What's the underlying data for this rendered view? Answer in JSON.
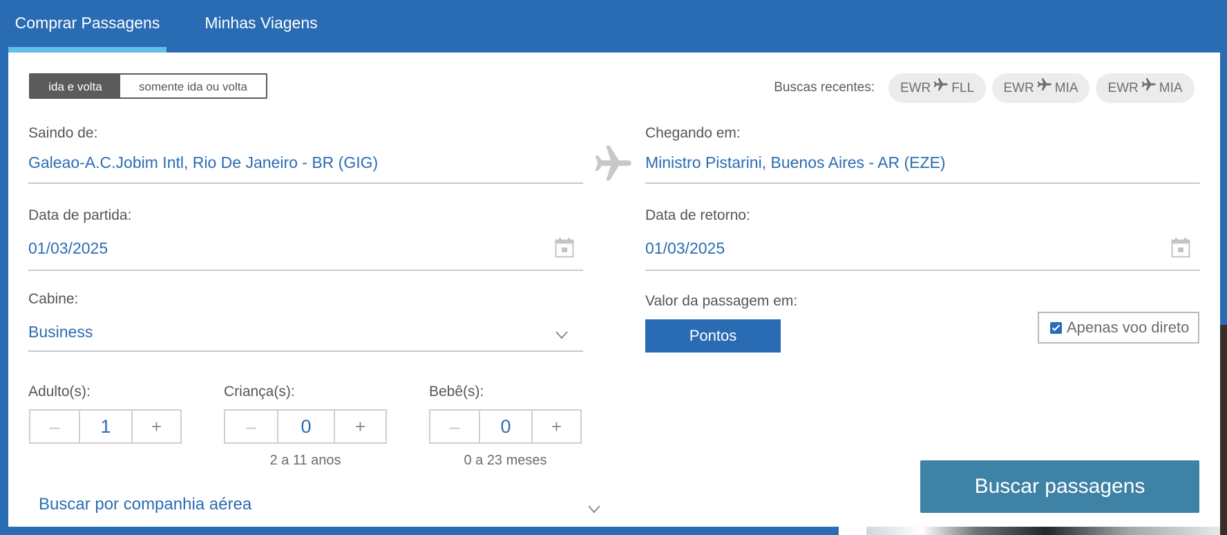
{
  "tabs": {
    "active": "Comprar Passagens",
    "second": "Minhas Viagens"
  },
  "trip_type": {
    "round_trip": "ida e volta",
    "one_way": "somente ida ou volta"
  },
  "recent": {
    "label": "Buscas recentes:",
    "items": [
      {
        "from": "EWR",
        "to": "FLL"
      },
      {
        "from": "EWR",
        "to": "MIA"
      },
      {
        "from": "EWR",
        "to": "MIA"
      }
    ]
  },
  "origin": {
    "label": "Saindo de:",
    "value": "Galeao-A.C.Jobim Intl, Rio De Janeiro - BR (GIG)"
  },
  "destination": {
    "label": "Chegando em:",
    "value": "Ministro Pistarini, Buenos Aires - AR (EZE)"
  },
  "departure": {
    "label": "Data de partida:",
    "value": "01/03/2025"
  },
  "return": {
    "label": "Data de retorno:",
    "value": "01/03/2025"
  },
  "cabin": {
    "label": "Cabine:",
    "value": "Business"
  },
  "fare": {
    "label": "Valor da passagem em:",
    "button": "Pontos"
  },
  "direct_only": {
    "label": "Apenas voo direto",
    "checked": true
  },
  "passengers": {
    "adults": {
      "label": "Adulto(s):",
      "minus": "–",
      "value": "1",
      "plus": "+"
    },
    "children": {
      "label": "Criança(s):",
      "minus": "–",
      "value": "0",
      "plus": "+",
      "hint": "2 a 11 anos"
    },
    "infants": {
      "label": "Bebê(s):",
      "minus": "–",
      "value": "0",
      "plus": "+",
      "hint": "0 a 23 meses"
    }
  },
  "search_button": "Buscar passagens",
  "airline_search": "Buscar por companhia aérea",
  "colors": {
    "primary": "#2a6cb3",
    "tab_indicator": "#5fc0e8",
    "search_button": "#3e82a6"
  }
}
